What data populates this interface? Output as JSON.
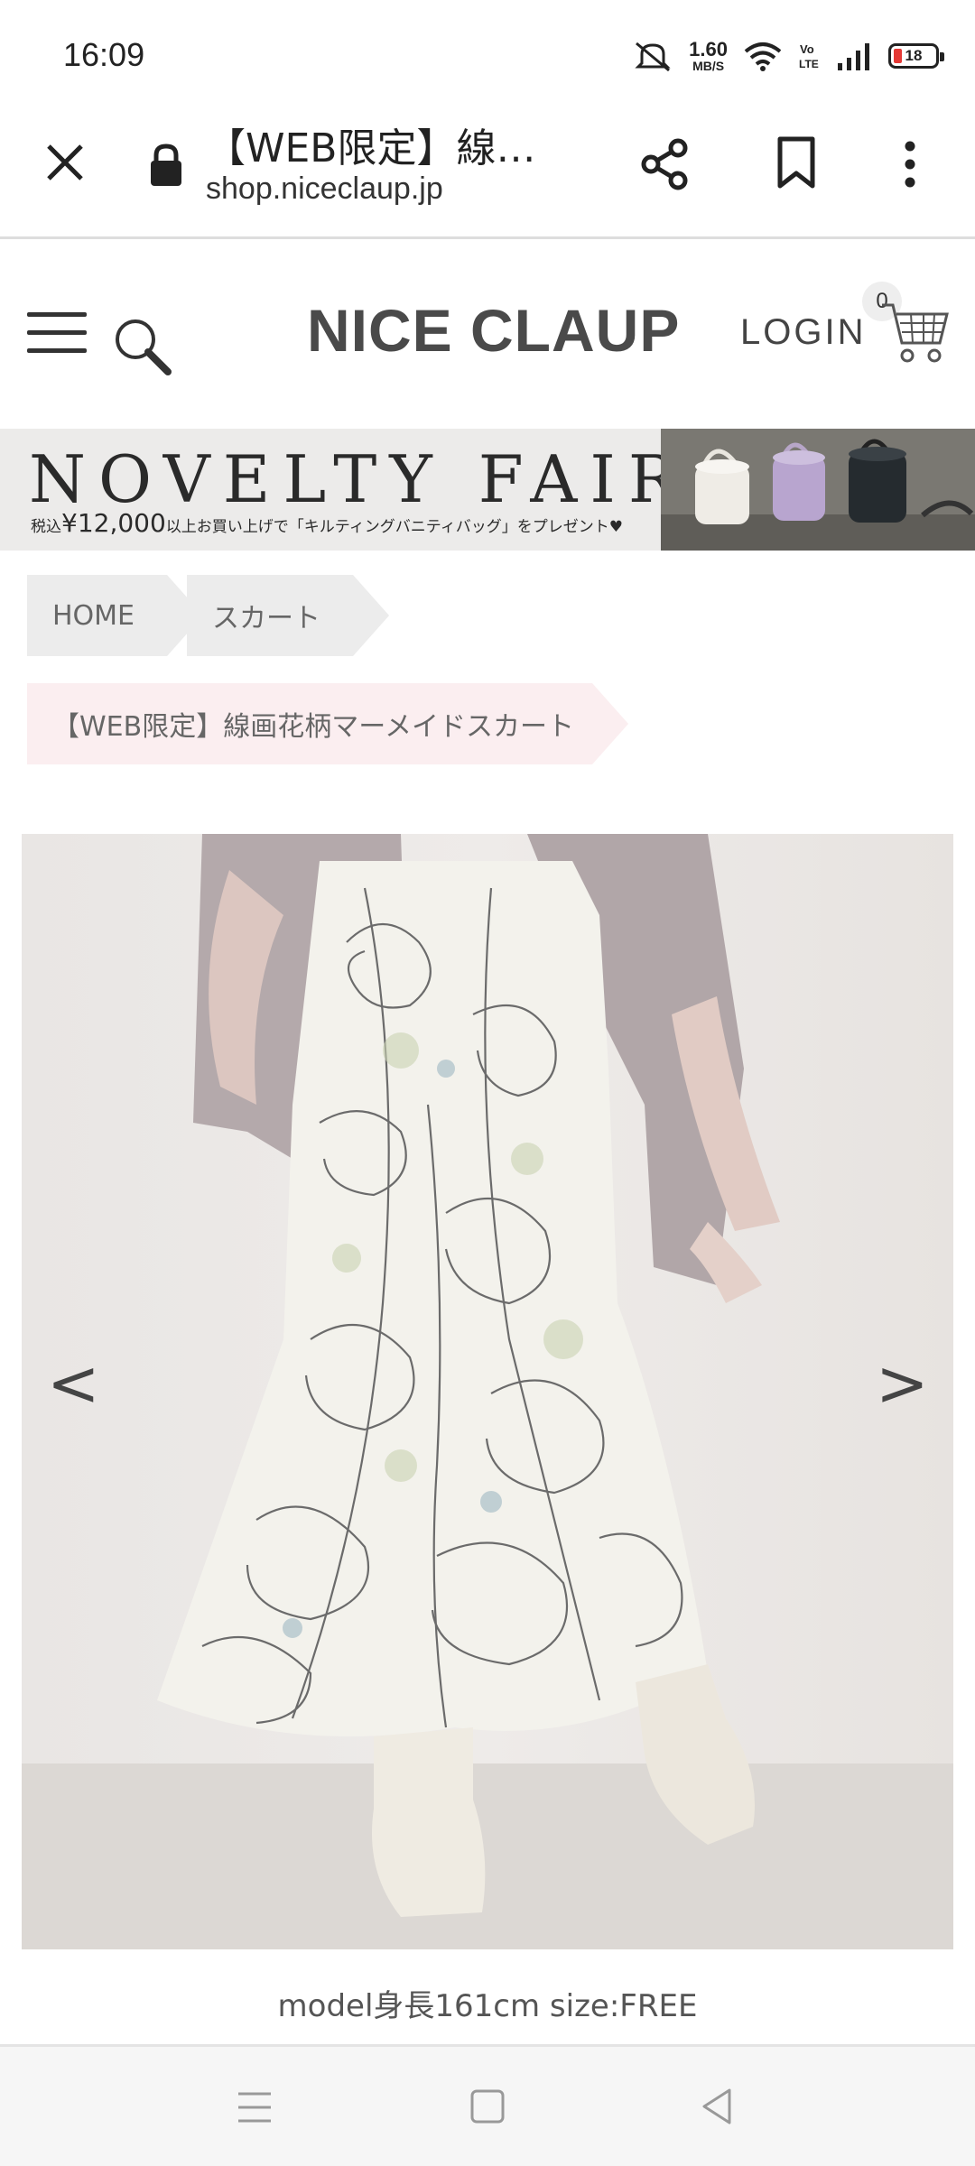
{
  "status_bar": {
    "time": "16:09",
    "net_speed_value": "1.60",
    "net_speed_unit": "MB/S",
    "battery_level": "18",
    "icons": [
      "mute-icon",
      "wifi-icon",
      "volte-icon",
      "signal-icon",
      "battery-icon"
    ]
  },
  "browser": {
    "tab_title": "【WEB限定】線…",
    "url": "shop.niceclaup.jp",
    "icons": [
      "close-icon",
      "lock-icon",
      "share-icon",
      "bookmark-icon",
      "more-vert-icon"
    ]
  },
  "header": {
    "logo": "NICE CLAUP",
    "login": "LOGIN",
    "cart_count": "0",
    "icons": [
      "menu-icon",
      "search-icon",
      "cart-icon"
    ]
  },
  "banner": {
    "title": "NOVELTY FAIR",
    "sub_prefix": "税込",
    "price": "¥12,000",
    "sub_suffix": "以上お買い上げで「キルティングバニティバッグ」をプレゼント♥"
  },
  "breadcrumbs": {
    "items": [
      "HOME",
      "スカート"
    ],
    "current": "【WEB限定】線画花柄マーメイドスカート"
  },
  "product": {
    "prev_arrow": "<",
    "next_arrow": ">",
    "caption": "model身長161cm size:FREE"
  },
  "system_nav": {
    "icons": [
      "recents-icon",
      "home-icon",
      "back-icon"
    ]
  },
  "colors": {
    "breadcrumb_bg": "#ececec",
    "current_crumb_bg": "#fbeef0",
    "logo": "#4a4a4a"
  }
}
